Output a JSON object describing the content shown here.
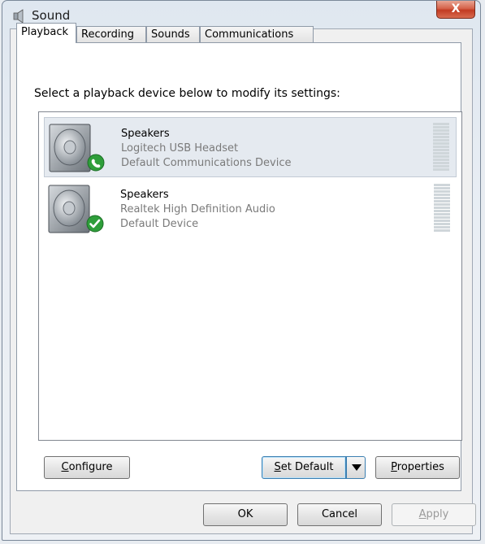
{
  "window": {
    "title": "Sound",
    "close_label": "X"
  },
  "tabs": [
    {
      "label": "Playback",
      "active": true
    },
    {
      "label": "Recording",
      "active": false
    },
    {
      "label": "Sounds",
      "active": false
    },
    {
      "label": "Communications",
      "active": false
    }
  ],
  "instruction": "Select a playback device below to modify its settings:",
  "devices": [
    {
      "name": "Speakers",
      "description": "Logitech USB Headset",
      "status": "Default Communications Device",
      "badge": "phone-icon",
      "selected": true
    },
    {
      "name": "Speakers",
      "description": "Realtek High Definition Audio",
      "status": "Default Device",
      "badge": "checkmark-icon",
      "selected": false
    }
  ],
  "buttons": {
    "configure": {
      "accel": "C",
      "rest": "onfigure"
    },
    "set_default": {
      "accel": "S",
      "rest": "et Default"
    },
    "properties": {
      "accel": "P",
      "rest": "roperties"
    },
    "ok": "OK",
    "cancel": "Cancel",
    "apply": {
      "accel": "A",
      "rest": "pply"
    }
  },
  "colors": {
    "badge_green": "#2e9e3a",
    "close_red": "#c9452b",
    "focus_blue": "#3c7fb1"
  }
}
